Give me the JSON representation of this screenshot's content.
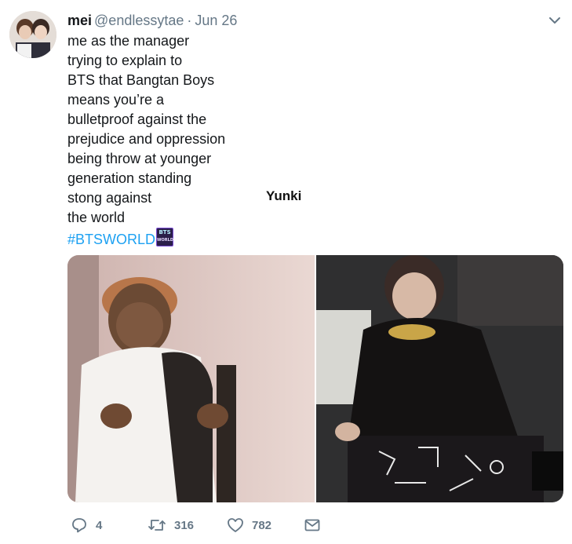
{
  "tweet": {
    "author": {
      "name": "mei",
      "handle": "@endlessytae",
      "date": "Jun 26"
    },
    "separator": "·",
    "text_lines": [
      "me as the manager",
      "trying to explain to",
      "BTS that Bangtan Boys",
      "means you’re a",
      "bulletproof against the",
      "prejudice and oppression",
      "being throw at younger",
      "generation standing",
      "stong against",
      "the world"
    ],
    "hashtag": "#BTSWORLD",
    "hashtag_badge": {
      "line1": "BTS",
      "line2": "WORLD"
    },
    "caption": "Yunki",
    "stats": {
      "replies": "4",
      "retweets": "316",
      "likes": "782"
    },
    "icons": {
      "menu": "chevron-down-icon",
      "reply": "reply-icon",
      "retweet": "retweet-icon",
      "like": "heart-icon",
      "dm": "envelope-icon"
    },
    "colors": {
      "link": "#1da1f2",
      "secondary": "#657786",
      "text": "#14171a"
    }
  }
}
